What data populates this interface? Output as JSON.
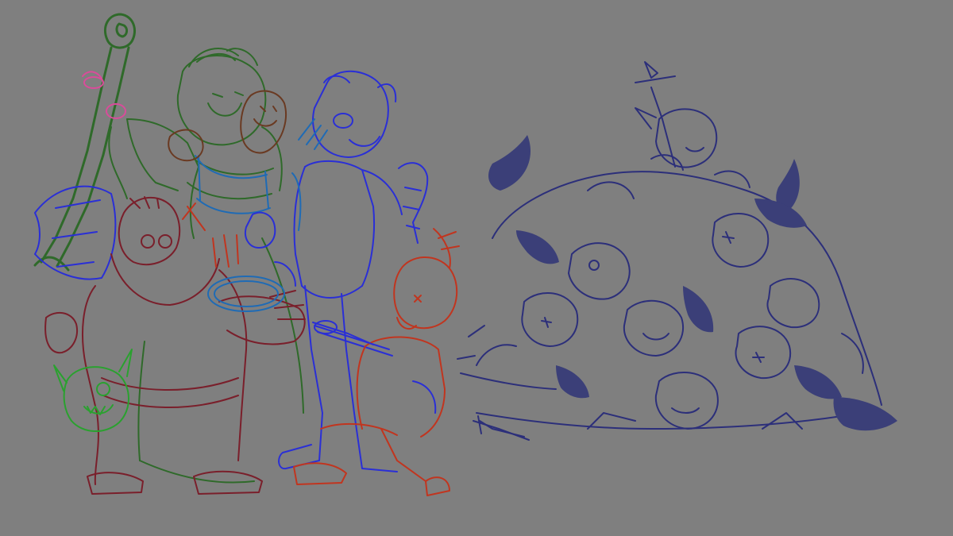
{
  "canvas": {
    "background": "#7f7f7f"
  },
  "palette": {
    "wizard_green": "#2f6a2a",
    "staff_pink": "#d94c9a",
    "rogue_blue": "#2a2fd6",
    "ranger_teal": "#1f6bb5",
    "dwarf_maroon": "#7a1f2b",
    "kid_red": "#c1351f",
    "goblin_green": "#2aa12f",
    "pile_navy": "#2c2f7a",
    "pile_fill": "#3b3f78",
    "beard_brown": "#6a3a22"
  },
  "scene": {
    "subjects": [
      "wizard-with-staff",
      "dwarf-with-axe",
      "eyepatch-ranger",
      "kid-with-feather-hat",
      "goblin-head",
      "goblin-pile"
    ]
  }
}
